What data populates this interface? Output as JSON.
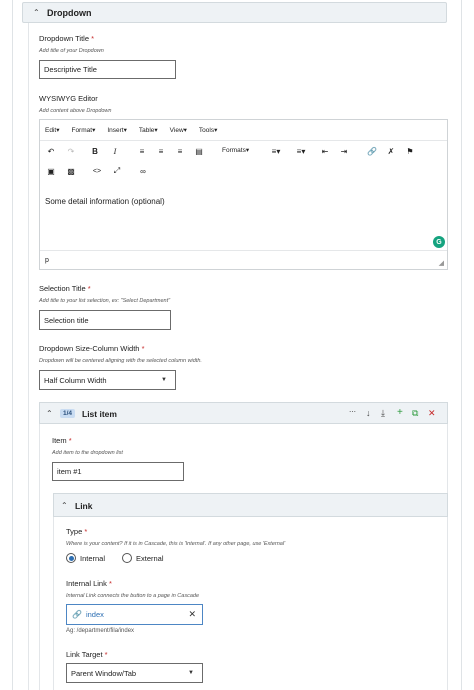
{
  "section": {
    "title": "Dropdown"
  },
  "dropdown_title": {
    "label": "Dropdown Title",
    "required_mark": "*",
    "help": "Add title of your Dropdown",
    "value": "Descriptive Title"
  },
  "wysiwyg": {
    "label": "WYSIWYG Editor",
    "help": "Add content above Dropdown",
    "menus": [
      "Edit",
      "Format",
      "Insert",
      "Table",
      "View",
      "Tools"
    ],
    "formats_label": "Formats",
    "content": "Some detail information (optional)",
    "status_path": "p"
  },
  "selection_title": {
    "label": "Selection Title",
    "required_mark": "*",
    "help": "Add title to your list selection, ex: \"Select Department\"",
    "value": "Selection title"
  },
  "size_width": {
    "label": "Dropdown Size-Column Width",
    "required_mark": "*",
    "help": "Dropdown will be centered aligning with the selected column width.",
    "value": "Half Column Width"
  },
  "list_item": {
    "badge": "1/4",
    "title": "List item",
    "item": {
      "label": "Item",
      "required_mark": "*",
      "help": "Add item to the dropdown list",
      "value": "item #1"
    },
    "link": {
      "title": "Link",
      "type": {
        "label": "Type",
        "required_mark": "*",
        "help": "Where is your content? If it is in Cascade, this is 'Internal'. If any other page, use 'External'",
        "options": [
          "Internal",
          "External"
        ],
        "selected": "Internal"
      },
      "internal_link": {
        "label": "Internal Link",
        "required_mark": "*",
        "help": "Internal Link connects the button to a page in Cascade",
        "value": "index",
        "path": "Ag: /department/fila/index"
      },
      "link_target": {
        "label": "Link Target",
        "required_mark": "*",
        "value": "Parent Window/Tab"
      }
    }
  }
}
